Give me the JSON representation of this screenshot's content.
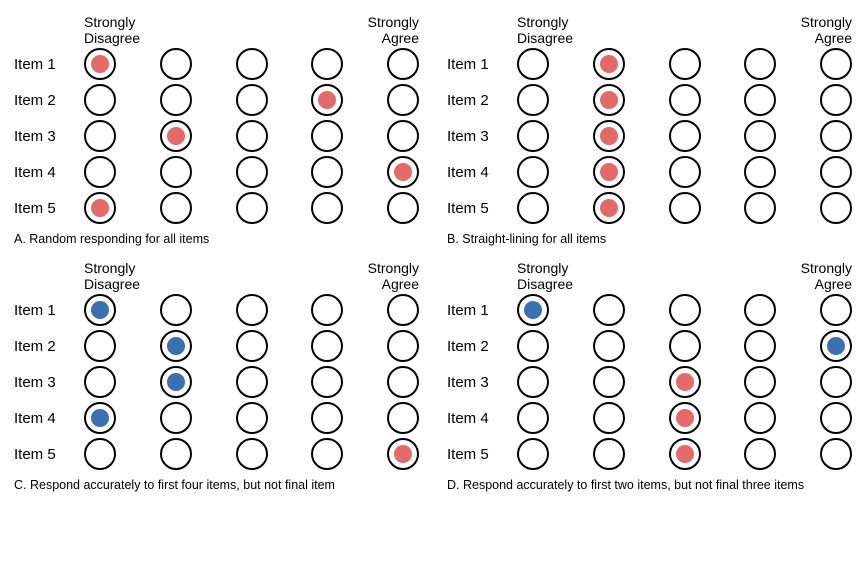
{
  "colors": {
    "accurate": "#3a6fb0",
    "inaccurate": "#e46a6a"
  },
  "scale_labels": {
    "left_l1": "Strongly",
    "left_l2": "Disagree",
    "right_l1": "Strongly",
    "right_l2": "Agree"
  },
  "item_labels": [
    "Item 1",
    "Item 2",
    "Item 3",
    "Item 4",
    "Item 5"
  ],
  "panels": [
    {
      "caption": "A. Random responding for all items",
      "responses": [
        {
          "pos": 0,
          "accurate": false
        },
        {
          "pos": 3,
          "accurate": false
        },
        {
          "pos": 1,
          "accurate": false
        },
        {
          "pos": 4,
          "accurate": false
        },
        {
          "pos": 0,
          "accurate": false
        }
      ]
    },
    {
      "caption": "B. Straight-lining for all items",
      "responses": [
        {
          "pos": 1,
          "accurate": false
        },
        {
          "pos": 1,
          "accurate": false
        },
        {
          "pos": 1,
          "accurate": false
        },
        {
          "pos": 1,
          "accurate": false
        },
        {
          "pos": 1,
          "accurate": false
        }
      ]
    },
    {
      "caption": "C. Respond accurately to first four items, but not final item",
      "responses": [
        {
          "pos": 0,
          "accurate": true
        },
        {
          "pos": 1,
          "accurate": true
        },
        {
          "pos": 1,
          "accurate": true
        },
        {
          "pos": 0,
          "accurate": true
        },
        {
          "pos": 4,
          "accurate": false
        }
      ]
    },
    {
      "caption": "D. Respond accurately to first two items, but not final three items",
      "responses": [
        {
          "pos": 0,
          "accurate": true
        },
        {
          "pos": 4,
          "accurate": true
        },
        {
          "pos": 2,
          "accurate": false
        },
        {
          "pos": 2,
          "accurate": false
        },
        {
          "pos": 2,
          "accurate": false
        }
      ]
    }
  ],
  "chart_data": {
    "type": "table",
    "description": "Four Likert-scale response pattern illustrations across 5 items and 5-point scale",
    "scale_points": 5,
    "scale_anchors": {
      "1": "Strongly Disagree",
      "5": "Strongly Agree"
    },
    "panels": [
      {
        "id": "A",
        "label": "Random responding for all items",
        "responses": [
          1,
          4,
          2,
          5,
          1
        ],
        "accurate": [
          false,
          false,
          false,
          false,
          false
        ]
      },
      {
        "id": "B",
        "label": "Straight-lining for all items",
        "responses": [
          2,
          2,
          2,
          2,
          2
        ],
        "accurate": [
          false,
          false,
          false,
          false,
          false
        ]
      },
      {
        "id": "C",
        "label": "Respond accurately to first four items, but not final item",
        "responses": [
          1,
          2,
          2,
          1,
          5
        ],
        "accurate": [
          true,
          true,
          true,
          true,
          false
        ]
      },
      {
        "id": "D",
        "label": "Respond accurately to first two items, but not final three items",
        "responses": [
          1,
          5,
          3,
          3,
          3
        ],
        "accurate": [
          true,
          true,
          false,
          false,
          false
        ]
      }
    ]
  }
}
